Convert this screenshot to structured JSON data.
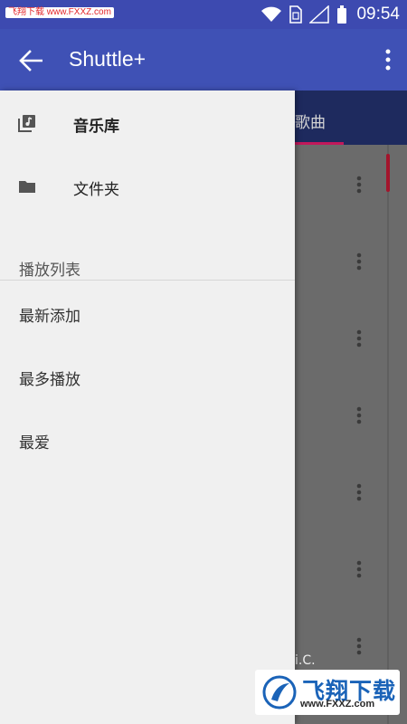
{
  "status_bar": {
    "watermark": "飞翔下载 www.FXXZ.com",
    "time": "09:54"
  },
  "app_bar": {
    "title": "Shuttle+"
  },
  "background": {
    "tab_label": "歌曲",
    "row_fragment": "i.C."
  },
  "drawer": {
    "nav_items": [
      {
        "label": "音乐库",
        "icon": "library-music-icon"
      },
      {
        "label": "文件夹",
        "icon": "folder-icon"
      }
    ],
    "section_header": "播放列表",
    "playlists": [
      {
        "label": "最新添加"
      },
      {
        "label": "最多播放"
      },
      {
        "label": "最爱"
      }
    ]
  },
  "watermark": {
    "name": "飞翔下载",
    "url": "www.FXXZ.com"
  },
  "colors": {
    "status_bar": "#3d4ab0",
    "app_bar": "#3f51b5",
    "tab_bar": "#1e2a5e",
    "accent": "#c2185b",
    "drawer_bg": "#f0f0f0",
    "scrim": "#6b6b6b"
  }
}
